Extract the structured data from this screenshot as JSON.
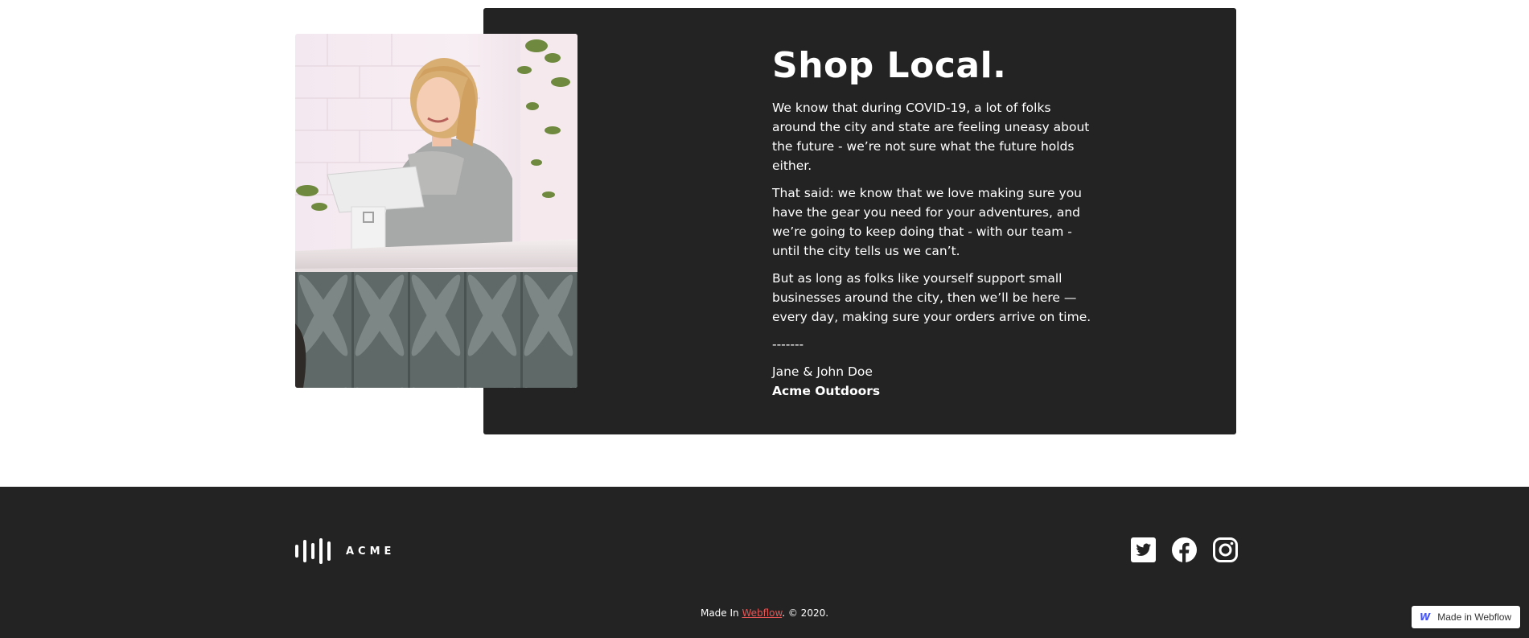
{
  "section": {
    "title": "Shop Local.",
    "paragraphs": [
      "We know that during COVID-19, a lot of folks around the city and state are feeling uneasy about the future - we’re not sure what the future holds either.",
      "That said: we know that we love making sure you have the gear you need for your adventures, and we’re going to keep doing that - with our team - until the city tells us we can’t.",
      "But as long as folks like yourself support small businesses around the city, then we’ll be here — every day, making sure your orders arrive on time."
    ],
    "divider": "-------",
    "signature_name": "Jane & John Doe",
    "signature_company": "Acme Outdoors",
    "photo_icon": "shopkeeper-photo"
  },
  "footer": {
    "logo_text": "ACME",
    "logo_icon": "sound-bars-icon",
    "socials": [
      "twitter-icon",
      "facebook-icon",
      "instagram-icon"
    ],
    "credit_prefix": "Made In ",
    "credit_link": "Webflow",
    "credit_suffix": ". © 2020."
  },
  "badge": {
    "logo": "W",
    "label": "Made in Webflow"
  },
  "colors": {
    "dark": "#232323",
    "link": "#e85555",
    "webflow_blue": "#4353ff"
  }
}
